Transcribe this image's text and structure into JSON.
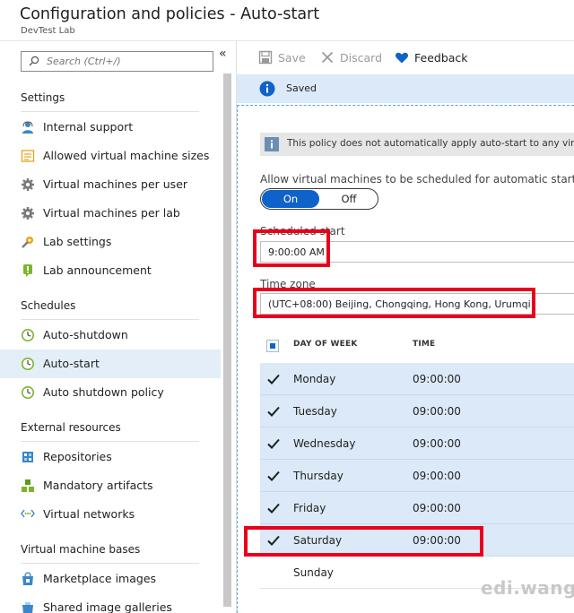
{
  "header": {
    "title": "Configuration and policies - Auto-start",
    "subtitle": "DevTest Lab"
  },
  "sidebar": {
    "collapse_glyph": "«",
    "search_placeholder": "Search (Ctrl+/)",
    "sections": [
      {
        "title": "Settings",
        "items": [
          {
            "label": "Internal support",
            "icon": "person-icon"
          },
          {
            "label": "Allowed virtual machine sizes",
            "icon": "list-icon"
          },
          {
            "label": "Virtual machines per user",
            "icon": "gear-icon"
          },
          {
            "label": "Virtual machines per lab",
            "icon": "gear-icon"
          },
          {
            "label": "Lab settings",
            "icon": "wrench-gear-icon"
          },
          {
            "label": "Lab announcement",
            "icon": "announcement-icon"
          }
        ]
      },
      {
        "title": "Schedules",
        "items": [
          {
            "label": "Auto-shutdown",
            "icon": "clock-icon"
          },
          {
            "label": "Auto-start",
            "icon": "clock-icon",
            "active": true
          },
          {
            "label": "Auto shutdown policy",
            "icon": "clock-icon"
          }
        ]
      },
      {
        "title": "External resources",
        "items": [
          {
            "label": "Repositories",
            "icon": "repository-icon"
          },
          {
            "label": "Mandatory artifacts",
            "icon": "artifacts-icon"
          },
          {
            "label": "Virtual networks",
            "icon": "network-icon"
          }
        ]
      },
      {
        "title": "Virtual machine bases",
        "items": [
          {
            "label": "Marketplace images",
            "icon": "marketplace-icon"
          },
          {
            "label": "Shared image galleries",
            "icon": "gallery-icon"
          }
        ]
      }
    ]
  },
  "toolbar": {
    "save_label": "Save",
    "discard_label": "Discard",
    "feedback_label": "Feedback"
  },
  "notification": {
    "text": "Saved"
  },
  "policy": {
    "info_text": "This policy does not automatically apply auto-start to any vir",
    "allow_label": "Allow virtual machines to be scheduled for automatic start",
    "toggle_on": "On",
    "toggle_off": "Off",
    "toggle_state": "On",
    "scheduled_start_label": "Scheduled start",
    "scheduled_start_value": "9:00:00 AM",
    "time_zone_label": "Time zone",
    "time_zone_value": "(UTC+08:00) Beijing, Chongqing, Hong Kong, Urumqi"
  },
  "schedule_table": {
    "columns": [
      "DAY OF WEEK",
      "TIME"
    ],
    "rows": [
      {
        "day": "Monday",
        "time": "09:00:00",
        "checked": true
      },
      {
        "day": "Tuesday",
        "time": "09:00:00",
        "checked": true
      },
      {
        "day": "Wednesday",
        "time": "09:00:00",
        "checked": true
      },
      {
        "day": "Thursday",
        "time": "09:00:00",
        "checked": true
      },
      {
        "day": "Friday",
        "time": "09:00:00",
        "checked": true
      },
      {
        "day": "Saturday",
        "time": "09:00:00",
        "checked": true
      },
      {
        "day": "Sunday",
        "time": "",
        "checked": false
      }
    ]
  },
  "watermark": "edi.wang",
  "colors": {
    "accent": "#0f62c9",
    "selection": "#dbe9f8",
    "highlight_box": "#e8001c"
  }
}
